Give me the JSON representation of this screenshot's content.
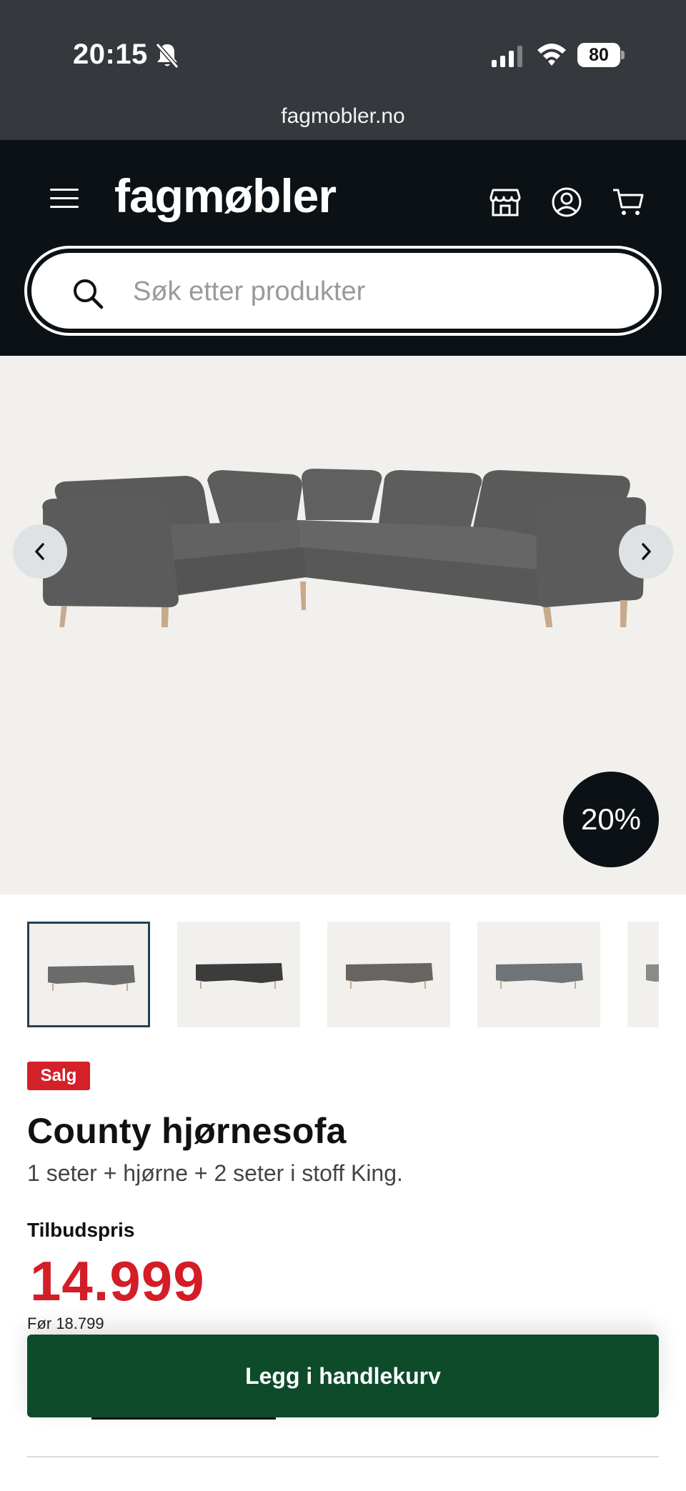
{
  "status_bar": {
    "time": "20:15",
    "battery": "80",
    "url": "fagmobler.no"
  },
  "header": {
    "logo": "fagmøbler",
    "icons": [
      "menu-icon",
      "store-icon",
      "account-icon",
      "cart-icon"
    ]
  },
  "search": {
    "placeholder": "Søk etter produkter"
  },
  "product": {
    "discount_badge": "20%",
    "sale_badge": "Salg",
    "title": "County hjørnesofa",
    "subtitle": "1 seter + hjørne + 2 seter i stoff King.",
    "price_label": "Tilbudspris",
    "price": "14.999",
    "old_price": "Før 18.799",
    "add_to_cart": "Legg i handlekurv"
  },
  "thumbnails": [
    {
      "color": "#6b6b6b",
      "selected": true
    },
    {
      "color": "#3c3c3c",
      "selected": false
    },
    {
      "color": "#6a6460",
      "selected": false
    },
    {
      "color": "#707378",
      "selected": false
    },
    {
      "color": "#8a8a8a",
      "selected": false
    }
  ],
  "colors": {
    "header_bg": "#0b1114",
    "sale_red": "#d42028",
    "price_red": "#d31d27",
    "cart_green": "#0d4b2b",
    "hero_bg": "#f2f0ed"
  }
}
